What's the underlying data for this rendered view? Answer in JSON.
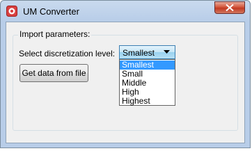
{
  "window": {
    "title": "UM Converter",
    "close_icon": "close-icon",
    "app_icon": "app-icon"
  },
  "group": {
    "label": "Import parameters:"
  },
  "discretization": {
    "label": "Select discretization level:",
    "selected_value": "Smallest",
    "options": [
      "Smallest",
      "Small",
      "Middle",
      "High",
      "Highest"
    ],
    "highlighted_index": 0
  },
  "actions": {
    "get_data_label": "Get data from file"
  },
  "colors": {
    "selection": "#3399ff",
    "close_button": "#c9462c"
  }
}
